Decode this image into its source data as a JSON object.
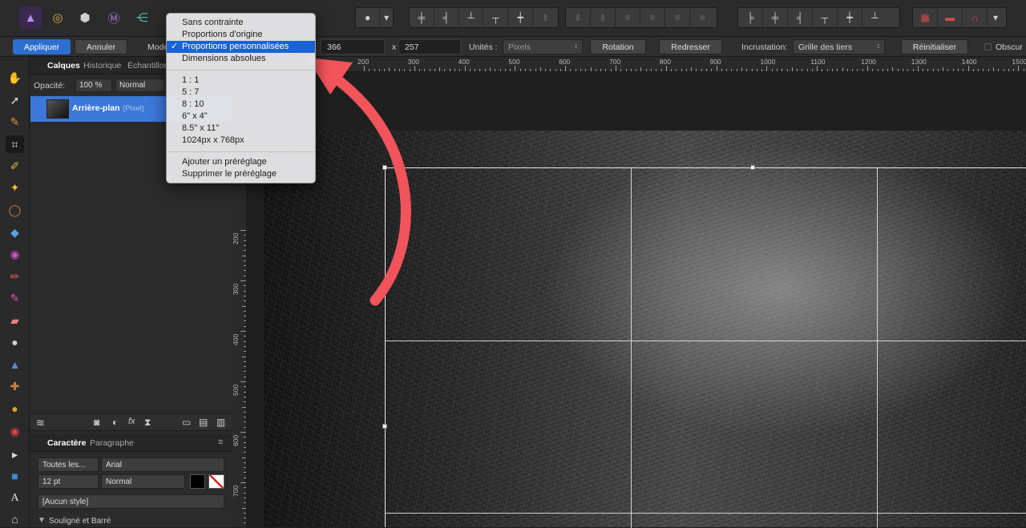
{
  "top_toolbar": {
    "persona_icons": [
      "affinity-logo-icon",
      "photo-persona-icon",
      "liquify-persona-icon",
      "develop-persona-icon",
      "export-persona-icon"
    ]
  },
  "context_bar": {
    "apply_label": "Appliquer",
    "cancel_label": "Annuler",
    "mode_label": "Mode",
    "width_value": "366",
    "times_symbol": "x",
    "height_value": "257",
    "units_label": "Unités :",
    "units_value": "Pixels",
    "rotation_label": "Rotation",
    "straighten_label": "Redresser",
    "overlay_label": "Incrustation:",
    "overlay_value": "Grille des tiers",
    "reset_label": "Réinitialiser",
    "darken_label": "Obscur"
  },
  "mode_menu": {
    "items": [
      {
        "label": "Sans contrainte",
        "checked": false,
        "highlighted": false
      },
      {
        "label": "Proportions d'origine",
        "checked": false,
        "highlighted": false
      },
      {
        "label": "Proportions personnalisées",
        "checked": true,
        "highlighted": true
      },
      {
        "label": "Dimensions absolues",
        "checked": false,
        "highlighted": false
      }
    ],
    "check_mark": "✓",
    "presets": [
      "1 : 1",
      "5 : 7",
      "8 : 10",
      "6\" x 4\"",
      "8.5\" x 11\"",
      "1024px x 768px"
    ],
    "actions": [
      "Ajouter un préréglage",
      "Supprimer le préréglage"
    ]
  },
  "layers_panel": {
    "tabs": [
      "Calques",
      "Historique",
      "Échantillons"
    ],
    "opacity_label": "Opacité:",
    "opacity_value": "100 %",
    "blend_mode": "Normal",
    "layer_name": "Arrière-plan",
    "layer_type": "(Pixel)"
  },
  "character_panel": {
    "tabs": [
      "Caractère",
      "Paragraphe"
    ],
    "language_value": "Toutes les...",
    "font_value": "Arial",
    "size_value": "12 pt",
    "weight_value": "Normal",
    "style_value": "[Aucun style]",
    "section_label": "Souligné et Barré"
  },
  "rulers": {
    "horizontal_ticks": [
      "200",
      "300",
      "400",
      "500",
      "600",
      "700",
      "800",
      "900",
      "1000",
      "1100",
      "1200",
      "1300",
      "1400",
      "1500"
    ],
    "vertical_ticks": [
      "200",
      "300",
      "400",
      "500",
      "600",
      "700"
    ]
  },
  "colors": {
    "accent": "#2d6fd0",
    "annotation_arrow": "#f2545b",
    "menu_highlight": "#1a63d6"
  }
}
